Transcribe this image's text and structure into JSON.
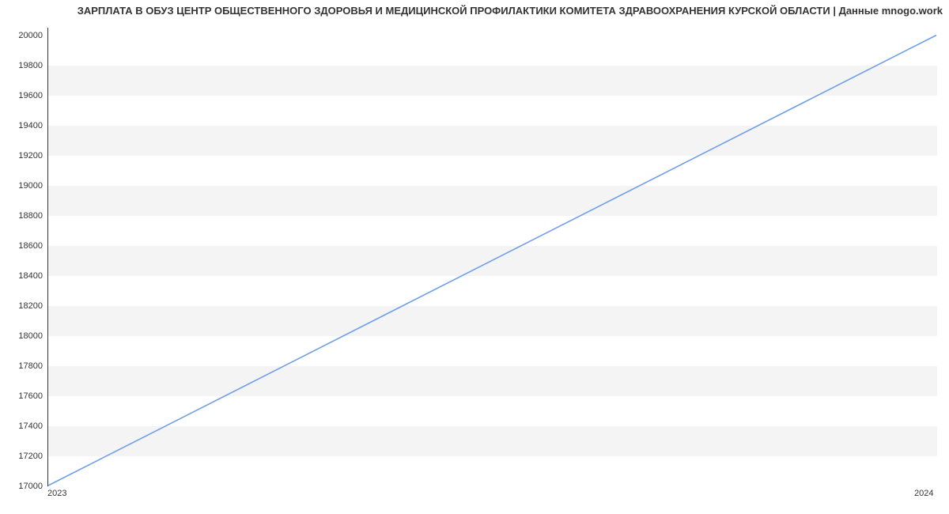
{
  "chart_data": {
    "type": "line",
    "title": "ЗАРПЛАТА В ОБУЗ ЦЕНТР ОБЩЕСТВЕННОГО ЗДОРОВЬЯ И МЕДИЦИНСКОЙ ПРОФИЛАКТИКИ КОМИТЕТА ЗДРАВООХРАНЕНИЯ КУРСКОЙ ОБЛАСТИ | Данные mnogo.work",
    "xlabel": "",
    "ylabel": "",
    "categories": [
      "2023",
      "2024"
    ],
    "values": [
      17000,
      20000
    ],
    "y_ticks": [
      17000,
      17200,
      17400,
      17600,
      17800,
      18000,
      18200,
      18400,
      18600,
      18800,
      19000,
      19200,
      19400,
      19600,
      19800,
      20000
    ],
    "ylim": [
      17000,
      20050
    ],
    "xlim": [
      "2023",
      "2024"
    ],
    "line_color": "#6f9ee8"
  }
}
